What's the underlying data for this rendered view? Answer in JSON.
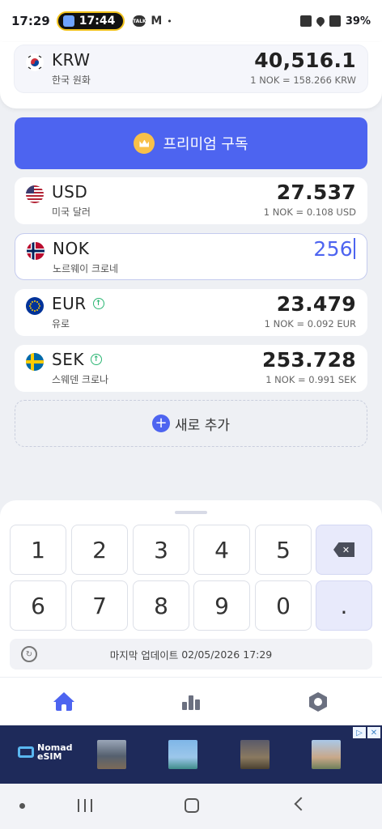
{
  "status_bar": {
    "time": "17:29",
    "call_time": "17:44",
    "talk_label": "TALK",
    "gmail_label": "M",
    "dot": "•",
    "battery": "39%"
  },
  "currencies": [
    {
      "code": "KRW",
      "name": "한국 원화",
      "amount": "40,516.1",
      "rate": "1 NOK = 158.266 KRW",
      "trend": false
    },
    {
      "code": "USD",
      "name": "미국 달러",
      "amount": "27.537",
      "rate": "1 NOK = 0.108 USD",
      "trend": false
    },
    {
      "code": "NOK",
      "name": "노르웨이 크로네",
      "amount": "256",
      "rate": "",
      "trend": false,
      "active": true
    },
    {
      "code": "EUR",
      "name": "유로",
      "amount": "23.479",
      "rate": "1 NOK = 0.092 EUR",
      "trend": true
    },
    {
      "code": "SEK",
      "name": "스웨덴 크로나",
      "amount": "253.728",
      "rate": "1 NOK = 0.991 SEK",
      "trend": true
    }
  ],
  "premium": {
    "label": "프리미엄 구독"
  },
  "add_new": {
    "label": "새로 추가"
  },
  "keypad": {
    "keys": [
      "1",
      "2",
      "3",
      "4",
      "5",
      "6",
      "7",
      "8",
      "9",
      "0",
      "."
    ]
  },
  "last_update": {
    "label": "마지막 업데이트",
    "value": "02/05/2026 17:29"
  },
  "bottom_nav": [
    "home-icon",
    "stats-icon",
    "settings-icon"
  ],
  "ad": {
    "brand_line1": "Nomad",
    "brand_line2": "eSIM"
  },
  "colors": {
    "accent": "#4d64f0",
    "up": "#2bb673",
    "premium_crown": "#f8c04a"
  }
}
